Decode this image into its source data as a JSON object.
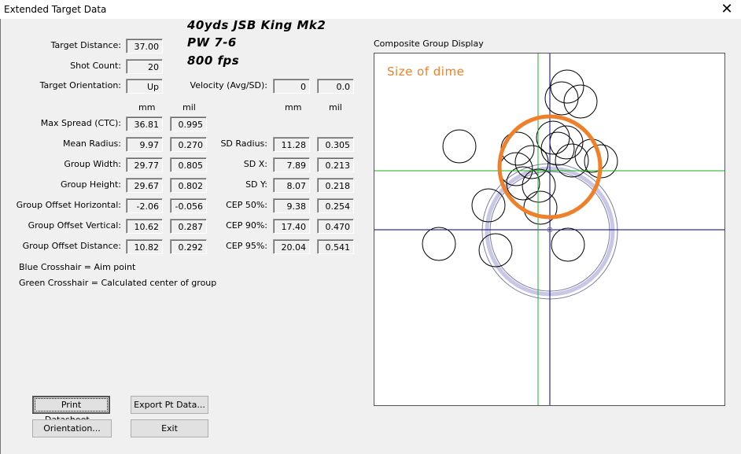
{
  "window": {
    "title": "Extended Target Data",
    "close_glyph": "✕"
  },
  "notes": {
    "line1": "40yds JSB King Mk2",
    "line2": "PW 7-6",
    "line3": "800 fps"
  },
  "basic": {
    "target_distance_label": "Target Distance:",
    "target_distance": "37.00",
    "shot_count_label": "Shot Count:",
    "shot_count": "20",
    "orientation_label": "Target Orientation:",
    "orientation": "Up",
    "velocity_label": "Velocity (Avg/SD):",
    "velocity_avg": "0",
    "velocity_sd": "0.0"
  },
  "units": {
    "mm": "mm",
    "mil": "mil"
  },
  "left_stats": [
    {
      "label": "Max Spread (CTC):",
      "mm": "36.81",
      "mil": "0.995"
    },
    {
      "label": "Mean Radius:",
      "mm": "9.97",
      "mil": "0.270"
    },
    {
      "label": "Group Width:",
      "mm": "29.77",
      "mil": "0.805"
    },
    {
      "label": "Group Height:",
      "mm": "29.67",
      "mil": "0.802"
    },
    {
      "label": "Group Offset Horizontal:",
      "mm": "-2.06",
      "mil": "-0.056"
    },
    {
      "label": "Group Offset Vertical:",
      "mm": "10.62",
      "mil": "0.287"
    },
    {
      "label": "Group Offset Distance:",
      "mm": "10.82",
      "mil": "0.292"
    }
  ],
  "right_stats": [
    {
      "label": "SD Radius:",
      "mm": "11.28",
      "mil": "0.305"
    },
    {
      "label": "SD X:",
      "mm": "7.89",
      "mil": "0.213"
    },
    {
      "label": "SD Y:",
      "mm": "8.07",
      "mil": "0.218"
    },
    {
      "label": "CEP 50%:",
      "mm": "9.38",
      "mil": "0.254"
    },
    {
      "label": "CEP 90%:",
      "mm": "17.40",
      "mil": "0.470"
    },
    {
      "label": "CEP 95%:",
      "mm": "20.04",
      "mil": "0.541"
    }
  ],
  "legend": {
    "blue": "Blue Crosshair = Aim point",
    "green": "Green Crosshair = Calculated center of group"
  },
  "display": {
    "title": "Composite Group Display",
    "annotation": "Size of dime",
    "annotation_color": "#f07f2a",
    "aim_color": "#00006e",
    "center_color": "#1ab31a"
  },
  "buttons": {
    "print": "Print Datasheet...",
    "export": "Export Pt Data...",
    "orientation": "Orientation...",
    "exit": "Exit"
  }
}
